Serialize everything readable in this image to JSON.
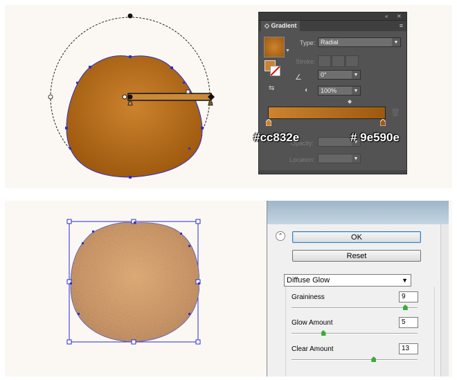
{
  "gradient_panel": {
    "tab_title": "Gradient",
    "collapse_glyph": "«",
    "close_glyph": "✕",
    "tab_glyph": "◇",
    "type_label": "Type:",
    "type_value": "Radial",
    "stroke_label": "Stroke:",
    "angle_value": "0°",
    "aspect_value": "100%",
    "opacity_label": "Opacity:",
    "location_label": "Location:",
    "start_color": "#cc832e",
    "end_color": "#9e590e",
    "start_hex_text": "#cc832e",
    "end_hex_text": "# 9e590e"
  },
  "dialog": {
    "ok_label": "OK",
    "reset_label": "Reset",
    "filter_value": "Diffuse Glow",
    "sliders": [
      {
        "label": "Graininess",
        "value": "9",
        "fraction": 0.9
      },
      {
        "label": "Glow Amount",
        "value": "5",
        "fraction": 0.25
      },
      {
        "label": "Clear Amount",
        "value": "13",
        "fraction": 0.65
      }
    ]
  },
  "colors": {
    "shape_light": "#cc832e",
    "shape_dark": "#9e590e",
    "selection": "#3030c8"
  }
}
